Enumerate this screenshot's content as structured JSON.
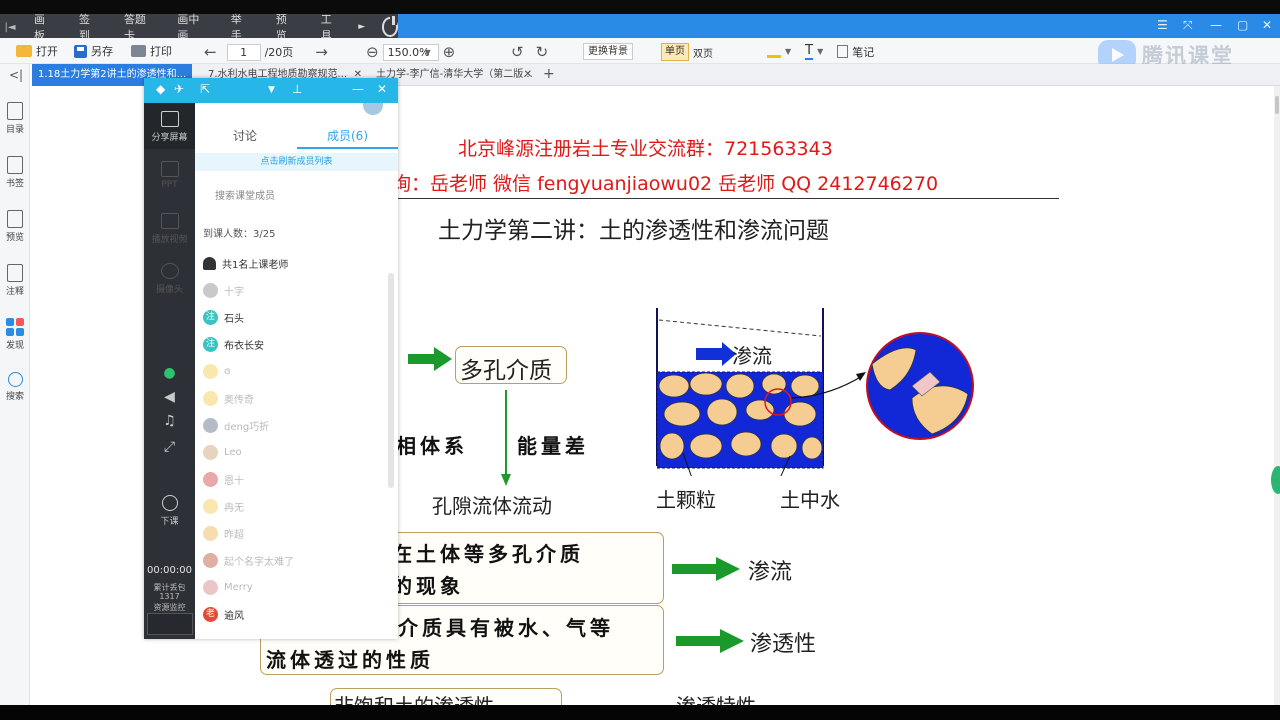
{
  "classroom_bar": {
    "items": [
      "画板",
      "签到",
      "答题卡",
      "画中画",
      "举手",
      "预览",
      "工具"
    ]
  },
  "toolbar": {
    "open": "打开",
    "save_as": "另存",
    "print": "打印",
    "page_current": "1",
    "page_total": "/20页",
    "zoom": "150.0%",
    "background": "更换背景",
    "single_page": "单页",
    "double_page": "双页",
    "notes": "笔记"
  },
  "tabs": [
    {
      "label": "1.18土力学第2讲土的渗透性和..."
    },
    {
      "label": "7.水利水电工程地质勘察规范..."
    },
    {
      "label": "土力学-李广信-清华大学（第二版..."
    }
  ],
  "sidebar": {
    "items": [
      {
        "label": "目录"
      },
      {
        "label": "书签"
      },
      {
        "label": "预览"
      },
      {
        "label": "注释"
      },
      {
        "label": "发现"
      },
      {
        "label": "搜索"
      }
    ]
  },
  "brand": {
    "name": "腾讯课堂"
  },
  "document": {
    "red_line_1": "北京峰源注册岩土专业交流群：721563343",
    "red_line_2": "询：岳老师 微信 fengyuanjiaowu02     岳老师 QQ 2412746270",
    "heading": "土力学第二讲：土的渗透性和渗流问题",
    "porous_media": "多孔介质",
    "seepage_label": "渗流",
    "soil_particle": "土颗粒",
    "soil_water": "土中水",
    "left_cond": "相体系",
    "energy_diff": "能量差",
    "pore_flow": "孔隙流体流动",
    "def1_line1": "体在土体等多孔介质",
    "def1_line2": "动的现象",
    "def1_result": "渗流",
    "def2_line1": "介质具有被水、气等",
    "def2_line2": "流体透过的性质",
    "def2_result": "渗透性",
    "bottom_left": "非饱和土的渗透性",
    "bottom_right": "渗透特性"
  },
  "classroom_panel": {
    "left_items": [
      {
        "label": "分享屏幕"
      },
      {
        "label": "PPT"
      },
      {
        "label": "播放视频"
      },
      {
        "label": "摄像头"
      }
    ],
    "end_class": "下课",
    "timer": "00:00:00",
    "packet_loss": "累计丢包",
    "packet_count": "1317",
    "resource_monitor": "资源监控",
    "tab_discuss": "讨论",
    "tab_members": "成员(6)",
    "refresh": "点击刷新成员列表",
    "search_placeholder": "搜索课堂成员",
    "attendance": "到课人数：3/25",
    "teacher_line": "共1名上课老师",
    "members": [
      {
        "name": "十字",
        "badge": "",
        "faded": true
      },
      {
        "name": "石头",
        "badge": "注",
        "faded": false
      },
      {
        "name": "布衣长安",
        "badge": "注",
        "faded": false
      },
      {
        "name": "ɞ",
        "badge": "",
        "faded": true
      },
      {
        "name": "奥传奇",
        "badge": "",
        "faded": true
      },
      {
        "name": "deng巧折",
        "badge": "",
        "faded": true
      },
      {
        "name": "Leo",
        "badge": "",
        "faded": true
      },
      {
        "name": "恩十",
        "badge": "",
        "faded": true
      },
      {
        "name": "冉无",
        "badge": "",
        "faded": true
      },
      {
        "name": "昨超",
        "badge": "",
        "faded": true
      },
      {
        "name": "起个名字太难了",
        "badge": "",
        "faded": true
      },
      {
        "name": "Merry",
        "badge": "",
        "faded": true
      },
      {
        "name": "逾风",
        "badge": "老",
        "faded": false
      }
    ]
  }
}
